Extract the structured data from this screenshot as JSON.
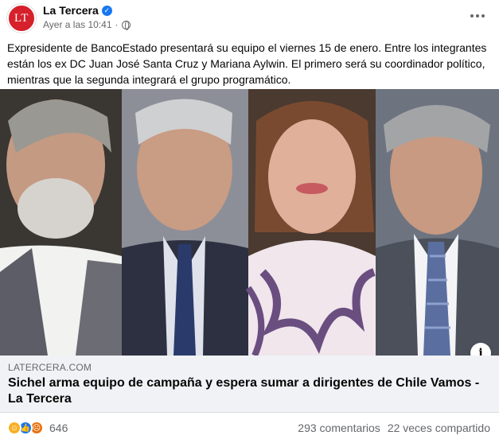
{
  "post": {
    "page_name": "La Tercera",
    "avatar_initials": "LT",
    "timestamp": "Ayer a las 10:41",
    "separator": "·",
    "text": "Expresidente de BancoEstado presentará su equipo el viernes 15 de enero. Entre los integrantes están los ex DC Juan José Santa Cruz y Mariana Aylwin. El primero será su coordinador político, mientras que la segunda integrará el grupo programático."
  },
  "link_preview": {
    "domain": "LATERCERA.COM",
    "title": "Sichel arma equipo de campaña y espera sumar a dirigentes de Chile Vamos - La Tercera",
    "info_symbol": "i"
  },
  "footer": {
    "reaction_count": "646",
    "comments": "293 comentarios",
    "shares": "22 veces compartido"
  },
  "colors": {
    "brand_red": "#d6202b",
    "verified_blue": "#1877f2",
    "secondary_text": "#65676b",
    "card_bg": "#f0f2f5"
  },
  "icons": [
    "verified-badge-icon",
    "globe-icon",
    "more-options-icon",
    "info-icon",
    "haha-reaction-icon",
    "like-reaction-icon",
    "angry-reaction-icon"
  ]
}
